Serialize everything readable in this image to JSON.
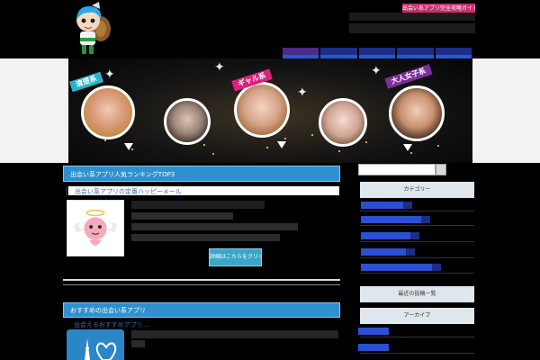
{
  "header": {
    "mascot_icon": "mascot-character-icon",
    "top_tag": "出会い系アプリ完全攻略ガイド",
    "nav_items": [
      "",
      "",
      "",
      "",
      ""
    ]
  },
  "hero": {
    "categories": [
      {
        "label": "清楚系",
        "color": "#2ab4c9"
      },
      {
        "label": "ギャル系",
        "color": "#e0207d"
      },
      {
        "label": "大人女子系",
        "color": "#7a2f9b"
      }
    ]
  },
  "main": {
    "section1_title": "出会い系アプリ人気ランキングTOP3",
    "entry1_title": "出会い系アプリの定番ハッピーメール",
    "entry1_rank": "1位",
    "more_button": "詳細はこちらをクリック",
    "section2_title": "おすすめの出会い系アプリ",
    "entry2_title": "出会えるおすすめアプリ…"
  },
  "sidebar": {
    "search_placeholder": "",
    "search_icon": "search-icon",
    "head1": "カテゴリー",
    "head2": "最近の投稿一覧",
    "head3": "アーカイブ"
  },
  "colors": {
    "accent": "#2e90cf",
    "pink": "#c7306e",
    "nav": "#2b50d4"
  }
}
